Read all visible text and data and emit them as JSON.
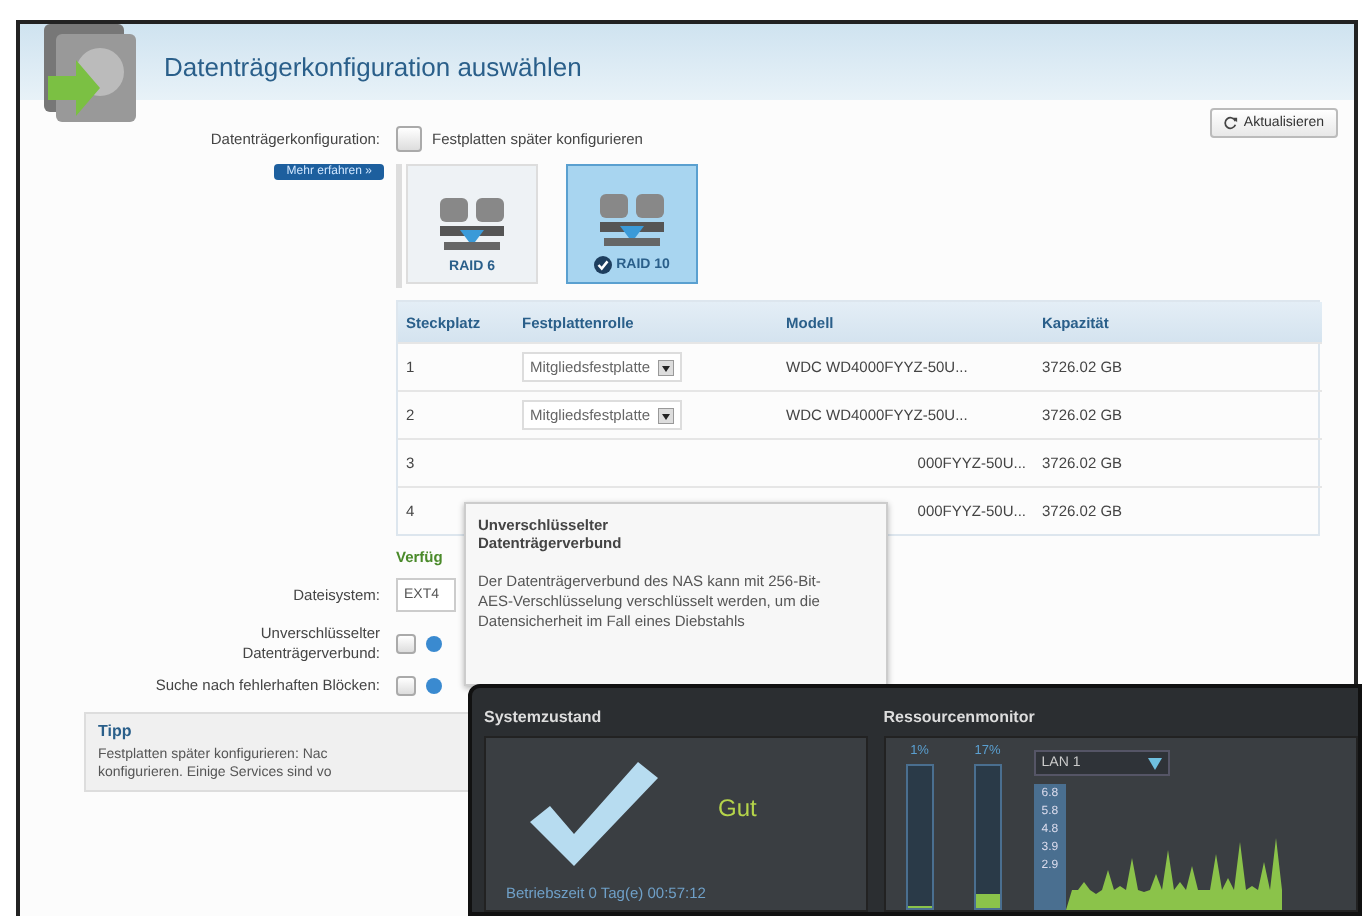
{
  "header": {
    "title": "Datenträgerkonfiguration auswählen"
  },
  "refresh_button": "Aktualisieren",
  "disk_config": {
    "label": "Datenträgerkonfiguration:",
    "checkbox_label": "Festplatten später konfigurieren",
    "checked": false
  },
  "learn_more": "Mehr erfahren »",
  "raid_options": [
    {
      "label": "RAID 6",
      "selected": false
    },
    {
      "label": "RAID 10",
      "selected": true
    }
  ],
  "table": {
    "columns": [
      "Steckplatz",
      "Festplattenrolle",
      "Modell",
      "Kapazität"
    ],
    "rows": [
      {
        "slot": "1",
        "role": "Mitgliedsfestplatte",
        "model": "WDC WD4000FYYZ-50U...",
        "capacity": "3726.02 GB"
      },
      {
        "slot": "2",
        "role": "Mitgliedsfestplatte",
        "model": "WDC WD4000FYYZ-50U...",
        "capacity": "3726.02 GB"
      },
      {
        "slot": "3",
        "model": "000FYYZ-50U...",
        "capacity": "3726.02 GB"
      },
      {
        "slot": "4",
        "model": "000FYYZ-50U...",
        "capacity": "3726.02 GB"
      }
    ]
  },
  "available_label": "Verfüg",
  "filesystem": {
    "label": "Dateisystem:",
    "value": "EXT4"
  },
  "options": [
    {
      "label": "Unverschlüsselter Datenträgerverbund:",
      "checked": false
    },
    {
      "label": "Suche nach fehlerhaften Blöcken:",
      "checked": false
    }
  ],
  "tip": {
    "title": "Tipp",
    "lines": [
      "Festplatten später konfigurieren: Nac",
      "konfigurieren. Einige Services sind vo"
    ]
  },
  "tooltip": {
    "title": "Unverschlüsselter Datenträgerverbund",
    "body": "Der Datenträgerverbund des NAS kann mit 256-Bit-AES-Verschlüsselung verschlüsselt werden, um die Datensicherheit im Fall eines Diebstahls"
  },
  "monitor_window": {
    "status_title": "Systemzustand",
    "status": "Gut",
    "uptime": "Betriebszeit 0 Tag(e) 00:57:12",
    "resource_title": "Ressourcenmonitor",
    "meters": [
      {
        "reading": "1%",
        "level": 0.02
      },
      {
        "reading": "17%",
        "level": 0.1
      }
    ],
    "network": "LAN 1",
    "scale": [
      "6.8",
      "5.8",
      "4.8",
      "3.9",
      "2.9"
    ]
  }
}
